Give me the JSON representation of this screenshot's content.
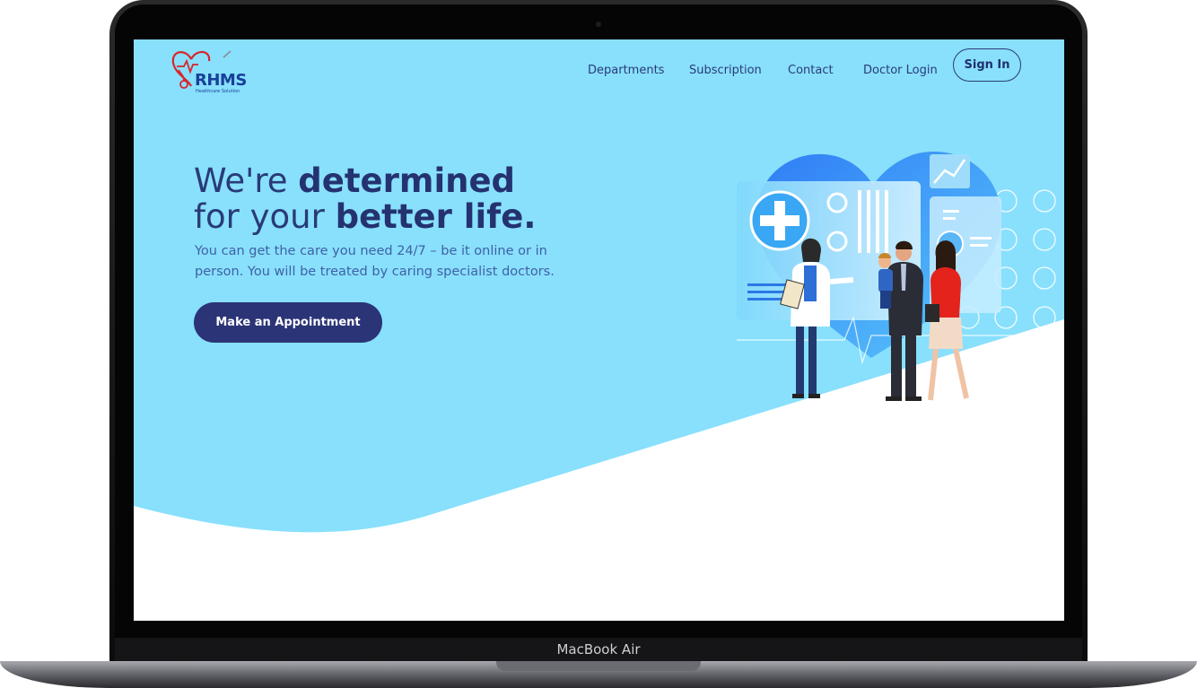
{
  "device": {
    "label": "MacBook Air"
  },
  "brand": {
    "name": "RHMS",
    "tagline": "Healthcare Solution"
  },
  "nav": {
    "links": [
      {
        "label": "Departments"
      },
      {
        "label": "Subscription"
      },
      {
        "label": "Contact"
      },
      {
        "label": "Doctor Login"
      }
    ],
    "sign_in_label": "Sign In"
  },
  "hero": {
    "headline_part1": "We're ",
    "headline_bold1": "determined",
    "headline_part2": " for your ",
    "headline_bold2": "better life.",
    "subtitle": "You can get the care you need 24/7 – be it online or in person. You will be treated by caring specialist doctors.",
    "cta_label": "Make an Appointment"
  },
  "colors": {
    "hero_bg": "#88e0fc",
    "primary": "#2b3476",
    "nav_text": "#2a3a7a",
    "accent_red": "#e2231a"
  }
}
